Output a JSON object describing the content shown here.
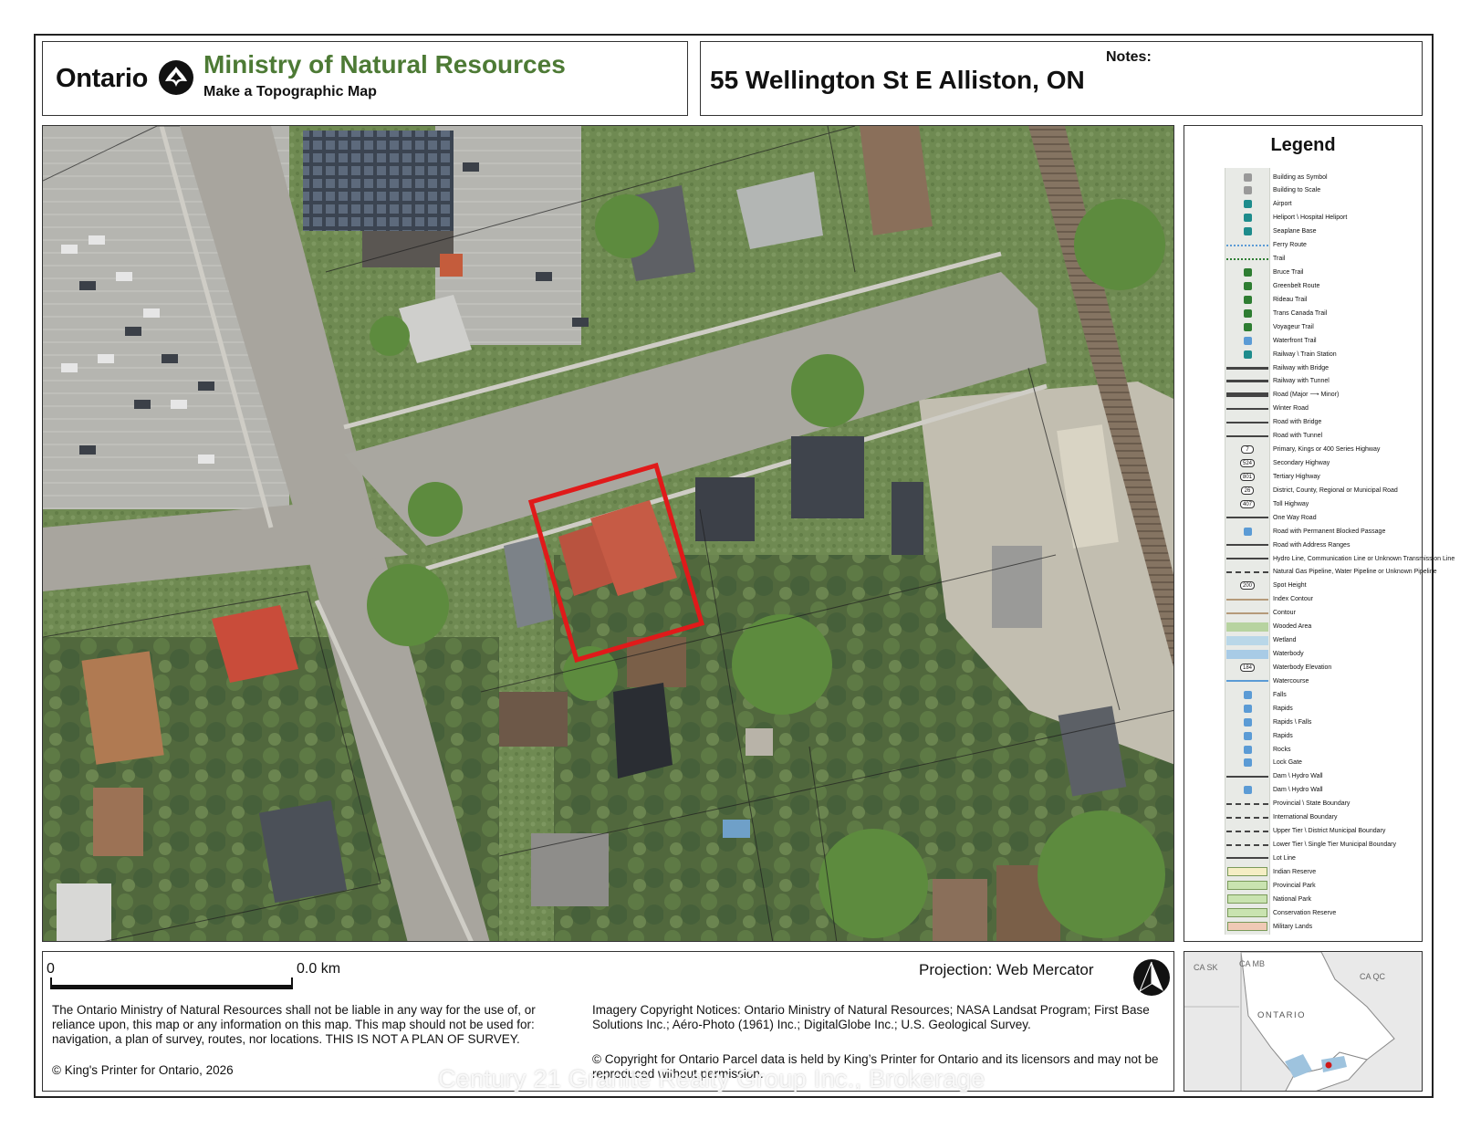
{
  "header": {
    "ontario_word": "Ontario",
    "ministry": "Ministry of Natural Resources",
    "subtitle": "Make a Topographic Map",
    "address": "55 Wellington St E Alliston, ON",
    "notes_label": "Notes:"
  },
  "legend": {
    "title": "Legend",
    "items": [
      {
        "label": "Building as Symbol",
        "symbol": "building-symbol-icon"
      },
      {
        "label": "Building to Scale",
        "symbol": "building-scale-icon"
      },
      {
        "label": "Airport",
        "symbol": "airport-icon"
      },
      {
        "label": "Heliport \\ Hospital Heliport",
        "symbol": "heliport-icon"
      },
      {
        "label": "Seaplane Base",
        "symbol": "seaplane-icon"
      },
      {
        "label": "Ferry Route",
        "symbol": "ferry-route-line"
      },
      {
        "label": "Trail",
        "symbol": "trail-line"
      },
      {
        "label": "Bruce Trail",
        "symbol": "bruce-trail-icon"
      },
      {
        "label": "Greenbelt Route",
        "symbol": "greenbelt-icon"
      },
      {
        "label": "Rideau Trail",
        "symbol": "rideau-trail-icon"
      },
      {
        "label": "Trans Canada Trail",
        "symbol": "trans-canada-trail-icon"
      },
      {
        "label": "Voyageur Trail",
        "symbol": "voyageur-trail-icon"
      },
      {
        "label": "Waterfront Trail",
        "symbol": "waterfront-trail-icon"
      },
      {
        "label": "Railway \\ Train Station",
        "symbol": "railway-station-icon"
      },
      {
        "label": "Railway with Bridge",
        "symbol": "railway-bridge-line"
      },
      {
        "label": "Railway with Tunnel",
        "symbol": "railway-tunnel-line"
      },
      {
        "label": "Road (Major ⟶ Minor)",
        "symbol": "road-major-minor-line"
      },
      {
        "label": "Winter Road",
        "symbol": "winter-road-line"
      },
      {
        "label": "Road with Bridge",
        "symbol": "road-bridge-line"
      },
      {
        "label": "Road with Tunnel",
        "symbol": "road-tunnel-line"
      },
      {
        "label": "Primary, Kings or 400 Series Highway",
        "symbol": "primary-highway-icon",
        "badge": "7"
      },
      {
        "label": "Secondary Highway",
        "symbol": "secondary-highway-icon",
        "badge": "524"
      },
      {
        "label": "Tertiary Highway",
        "symbol": "tertiary-highway-icon",
        "badge": "801"
      },
      {
        "label": "District, County, Regional or Municipal Road",
        "symbol": "county-road-icon",
        "badge": "26"
      },
      {
        "label": "Toll Highway",
        "symbol": "toll-highway-icon",
        "badge": "407"
      },
      {
        "label": "One Way Road",
        "symbol": "one-way-road-line"
      },
      {
        "label": "Road with Permanent Blocked Passage",
        "symbol": "blocked-road-icon"
      },
      {
        "label": "Road with Address Ranges",
        "symbol": "address-range-line",
        "ranges": [
          "420",
          "500",
          "421",
          "499"
        ]
      },
      {
        "label": "Hydro Line, Communication Line or Unknown Transmission Line",
        "symbol": "hydro-line"
      },
      {
        "label": "Natural Gas Pipeline, Water Pipeline or Unknown Pipeline",
        "symbol": "pipeline-line"
      },
      {
        "label": "Spot Height",
        "symbol": "spot-height-icon",
        "badge": "200"
      },
      {
        "label": "Index Contour",
        "symbol": "index-contour-line",
        "badge": "250"
      },
      {
        "label": "Contour",
        "symbol": "contour-line"
      },
      {
        "label": "Wooded Area",
        "symbol": "wooded-area-fill"
      },
      {
        "label": "Wetland",
        "symbol": "wetland-fill"
      },
      {
        "label": "Waterbody",
        "symbol": "waterbody-fill"
      },
      {
        "label": "Waterbody Elevation",
        "symbol": "waterbody-elevation-icon",
        "badge": "184"
      },
      {
        "label": "Watercourse",
        "symbol": "watercourse-line"
      },
      {
        "label": "Falls",
        "symbol": "falls-icon"
      },
      {
        "label": "Rapids",
        "symbol": "rapids-icon"
      },
      {
        "label": "Rapids \\ Falls",
        "symbol": "rapids-falls-icon"
      },
      {
        "label": "Rapids",
        "symbol": "rapids-area-icon"
      },
      {
        "label": "Rocks",
        "symbol": "rocks-icon"
      },
      {
        "label": "Lock Gate",
        "symbol": "lock-gate-icon"
      },
      {
        "label": "Dam \\ Hydro Wall",
        "symbol": "dam-line"
      },
      {
        "label": "Dam \\ Hydro Wall",
        "symbol": "dam-area-icon"
      },
      {
        "label": "Provincial \\ State Boundary",
        "symbol": "provincial-boundary-line"
      },
      {
        "label": "International Boundary",
        "symbol": "international-boundary-line"
      },
      {
        "label": "Upper Tier \\ District Municipal Boundary",
        "symbol": "upper-tier-boundary-line"
      },
      {
        "label": "Lower Tier \\ Single Tier Municipal Boundary",
        "symbol": "lower-tier-boundary-line"
      },
      {
        "label": "Lot Line",
        "symbol": "lot-line"
      },
      {
        "label": "Indian Reserve",
        "symbol": "indian-reserve-fill",
        "color": "#f5eec4"
      },
      {
        "label": "Provincial Park",
        "symbol": "provincial-park-fill",
        "color": "#c9e3b0"
      },
      {
        "label": "National Park",
        "symbol": "national-park-fill",
        "color": "#c9e3b0"
      },
      {
        "label": "Conservation Reserve",
        "symbol": "conservation-reserve-fill",
        "color": "#c9e3b0"
      },
      {
        "label": "Military Lands",
        "symbol": "military-lands-fill",
        "color": "#f0c9b5"
      }
    ]
  },
  "map": {
    "subject_outline_color": "#e01a1a",
    "scale_start": "0",
    "scale_end": "0.0 km",
    "projection": "Projection: Web Mercator",
    "north_arrow": "north-arrow-icon"
  },
  "footer": {
    "disclaimer": "The Ontario Ministry of Natural Resources shall not be liable in any way for the use of, or reliance upon, this map or any information on this map.  This map should not be used for: navigation, a plan of survey, routes, nor locations. THIS IS NOT A PLAN OF SURVEY.",
    "kings_printer": "© King's Printer for Ontario, 2026",
    "imagery": "Imagery Copyright Notices: Ontario Ministry of Natural Resources; NASA Landsat Program; First Base Solutions Inc.; Aéro-Photo (1961) Inc.; DigitalGlobe Inc.; U.S. Geological Survey.",
    "parcel": "© Copyright for Ontario Parcel data is held by King’s Printer for Ontario and its licensors and may not be reproduced without permission."
  },
  "inset": {
    "labels": [
      "CA SK",
      "CA MB",
      "ONTARIO",
      "CA QC"
    ],
    "marker_color": "#d01818"
  },
  "watermark": "Century 21 Granite Realty Group Inc., Brokerage"
}
